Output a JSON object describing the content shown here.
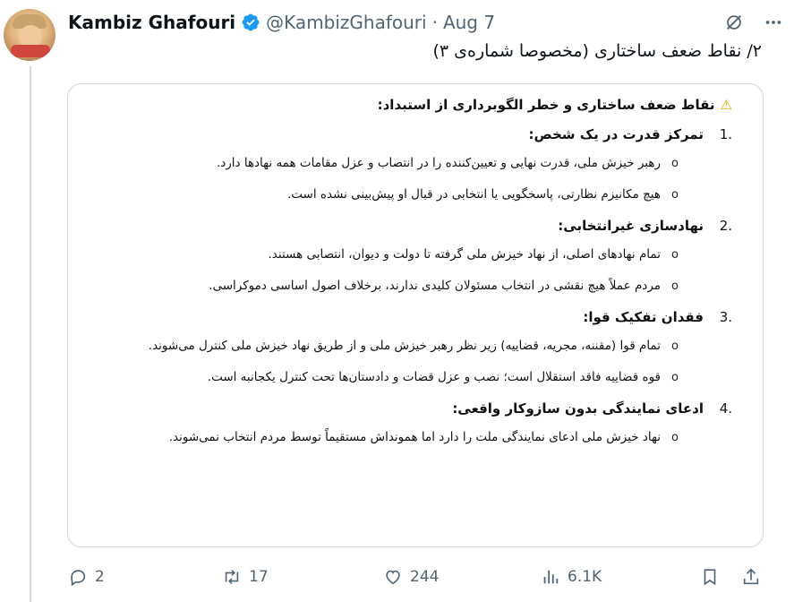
{
  "author": {
    "display_name": "Kambiz Ghafouri",
    "handle": "@KambizGhafouri",
    "separator": "·",
    "date": "Aug 7"
  },
  "tweet": {
    "text": "۲/ نقاط ضعف ساختاری (مخصوصا شماره‌ی ۳)"
  },
  "document": {
    "title": "نقاط ضعف ساختاری و خطر الگوبرداری از استبداد:",
    "title_icon": "warning-icon",
    "sections": [
      {
        "number": "1.",
        "heading": "تمرکز قدرت در یک شخص:",
        "bullets": [
          "رهبر خیزش ملی، قدرت نهایی و تعیین‌کننده را در انتصاب و عزل مقامات همه نهادها دارد.",
          "هیچ مکانیزم نظارتی، پاسخگویی یا انتخابی در قبال او پیش‌بینی نشده است."
        ]
      },
      {
        "number": "2.",
        "heading": "نهادسازی غیرانتخابی:",
        "bullets": [
          "تمام نهادهای اصلی، از نهاد خیزش ملی گرفته تا دولت و دیوان، انتصابی هستند.",
          "مردم عملاً هیچ نقشی در انتخاب مسئولان کلیدی ندارند، برخلاف اصول اساسی دموکراسی."
        ]
      },
      {
        "number": "3.",
        "heading": "فقدان تفکیک قوا:",
        "bullets": [
          "تمام قوا (مقننه، مجریه، قضاییه) زیر نظر رهبر خیزش ملی و از طریق نهاد خیزش ملی کنترل می‌شوند.",
          "قوه قضاییه فاقد استقلال است؛ نصب و عزل قضات و دادستان‌ها تحت کنترل یکجانبه است."
        ]
      },
      {
        "number": "4.",
        "heading": "ادعای نمایندگی بدون سازوکار واقعی:",
        "bullets": [
          "نهاد خیزش ملی ادعای نمایندگی ملت را دارد اما همونداش مستقیماً توسط مردم انتخاب نمی‌شوند."
        ]
      }
    ]
  },
  "actions": {
    "replies": "2",
    "reposts": "17",
    "likes": "244",
    "views": "6.1K"
  },
  "icons": {
    "verified": "verified-badge-icon",
    "grok": "grok-icon",
    "more": "more-icon",
    "reply": "reply-icon",
    "repost": "repost-icon",
    "like": "heart-icon",
    "views": "views-icon",
    "bookmark": "bookmark-icon",
    "share": "share-icon"
  },
  "colors": {
    "verified_blue": "#1d9bf0",
    "secondary_text": "#536471",
    "border": "#cfd9de"
  }
}
